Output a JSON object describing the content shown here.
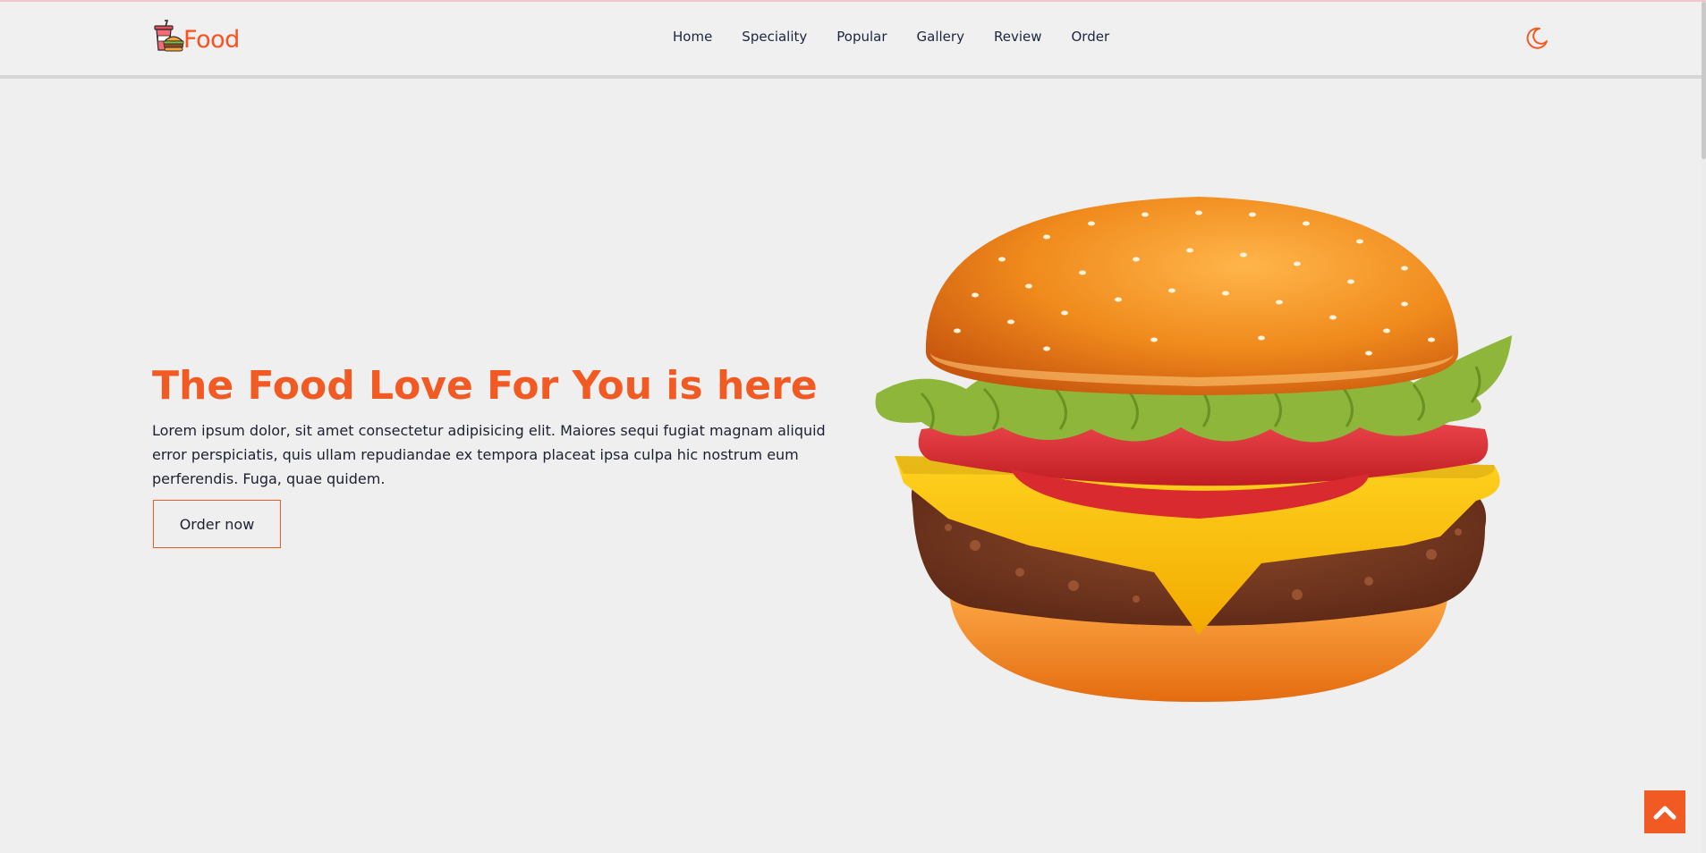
{
  "brand": {
    "name": "Food",
    "color": "#ff4f1f"
  },
  "nav": {
    "items": [
      {
        "label": "Home"
      },
      {
        "label": "Speciality"
      },
      {
        "label": "Popular"
      },
      {
        "label": "Gallery"
      },
      {
        "label": "Review"
      },
      {
        "label": "Order"
      }
    ]
  },
  "theme_toggle": {
    "icon": "moon-icon"
  },
  "hero": {
    "title": "The Food Love For You is here",
    "description": "Lorem ipsum dolor, sit amet consectetur adipisicing elit. Maiores sequi fugiat magnam aliquid error perspiciatis, quis ullam repudiandae ex tempora placeat ipsa culpa hic nostrum eum perferendis. Fuga, quae quidem.",
    "cta_label": "Order now",
    "accent_color": "#f25a24",
    "image": "burger-image"
  },
  "scroll_top": {
    "icon": "chevron-up-icon"
  }
}
